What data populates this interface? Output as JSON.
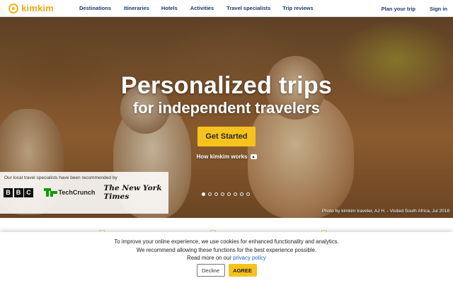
{
  "nav": {
    "logo_text": "kimkim",
    "links": [
      "Destinations",
      "Itineraries",
      "Hotels",
      "Activities",
      "Travel specialists",
      "Trip reviews"
    ],
    "plan_trip": "Plan your trip",
    "sign_in": "Sign in"
  },
  "hero": {
    "title": "Personalized trips",
    "subtitle": "for independent travelers",
    "cta": "Get Started",
    "how_it_works": "How kimkim works",
    "press_label": "Our local travel specialists have been recommended by",
    "press": {
      "bbc": [
        "B",
        "B",
        "C"
      ],
      "techcrunch": "TechCrunch",
      "nyt": "The New York Times"
    },
    "carousel_slides": 8,
    "carousel_active": 1,
    "photo_credit": "Photo by kimkim traveler, AJ H. - Visited South Africa, Jul 2018"
  },
  "cookie": {
    "line1": "To improve your online experience, we use cookies for enhanced functionality and analytics.",
    "line2": "We recommend allowing these functions for the best experience possible.",
    "line3_prefix": "Read more on our ",
    "privacy_link": "privacy policy",
    "decline": "Decline",
    "agree": "AGREE"
  },
  "colors": {
    "brand_yellow": "#f6c21c",
    "nav_text": "#1b3a6b",
    "link_blue": "#2263c4"
  }
}
